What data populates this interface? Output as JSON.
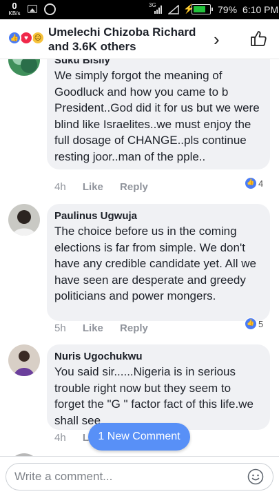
{
  "status_bar": {
    "speed_value": "0",
    "speed_unit": "KB/s",
    "network": "3G",
    "battery_percent": "79%",
    "battery_level": 0.79,
    "time": "6:10 PM"
  },
  "header": {
    "reactors_line1": "Umelechi Chizoba Richard",
    "reactors_line2": "and 3.6K others",
    "reaction_icons": [
      "like-icon",
      "love-icon",
      "sad-icon"
    ],
    "chevron": "›"
  },
  "comments": [
    {
      "name": "Suku Bisily",
      "text": "We simply forgot the meaning of Goodluck and how you came to b President..God did it for us but we were blind like Israelites..we must enjoy the full dosage of CHANGE..pls continue resting joor..man of the pple..",
      "time": "4h",
      "like_label": "Like",
      "reply_label": "Reply",
      "reactions": "4"
    },
    {
      "name": "Paulinus Ugwuja",
      "text": "The choice before us in the coming elections is far from simple. We don't have any credible candidate yet. All we have seen are desperate and greedy politicians and power mongers.",
      "time": "5h",
      "like_label": "Like",
      "reply_label": "Reply",
      "reactions": "5"
    },
    {
      "name": "Nuris Ugochukwu",
      "text": "You said sir......Nigeria is in serious trouble right now but they seem to forget the \"G \" factor fact of this life.we shall see.....",
      "time": "4h",
      "like_label": "Li",
      "reply_label": ""
    }
  ],
  "new_comment_pill": "1 New Comment",
  "composer": {
    "placeholder": "Write a comment..."
  },
  "colors": {
    "accent": "#5890f7",
    "like_blue": "#4a7cf5",
    "bubble_bg": "#f0f1f4",
    "meta_gray": "#90949c"
  }
}
